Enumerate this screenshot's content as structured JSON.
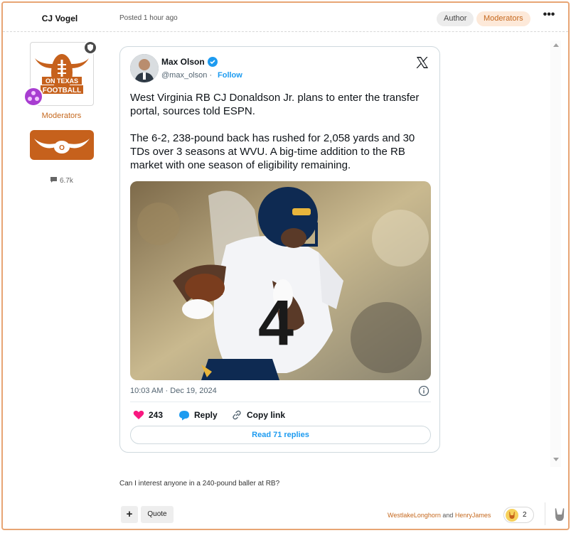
{
  "header": {
    "author": "CJ Vogel",
    "posted": "Posted 1 hour ago",
    "badges": [
      "Author",
      "Moderators"
    ],
    "more": "•••"
  },
  "sidebar": {
    "avatar_text": [
      "ON TEXAS",
      "FOOTBALL"
    ],
    "role": "Moderators",
    "reply_count": "6.7k"
  },
  "tweet": {
    "name": "Max Olson",
    "handle": "@max_olson",
    "separator": "·",
    "follow": "Follow",
    "text": "West Virginia RB CJ Donaldson Jr. plans to enter the transfer portal, sources told ESPN.\n\nThe 6-2, 238-pound back has rushed for 2,058 yards and 30 TDs over 3 seasons at WVU. A big-time addition to the RB market with one season of eligibility remaining.",
    "timestamp": "10:03 AM · Dec 19, 2024",
    "likes": "243",
    "reply_label": "Reply",
    "copy_label": "Copy link",
    "read_replies": "Read 71 replies",
    "jersey_number": "4"
  },
  "post": {
    "text": "Can I interest anyone in a 240-pound baller at RB?"
  },
  "footer": {
    "plus": "+",
    "quote": "Quote",
    "reactor1": "WestlakeLonghorn",
    "and": " and ",
    "reactor2": "HenryJames",
    "reaction_count": "2"
  },
  "colors": {
    "accent": "#c5681e",
    "border": "#e8a574",
    "twitter_blue": "#1d9bf0",
    "like_pink": "#f91880"
  }
}
